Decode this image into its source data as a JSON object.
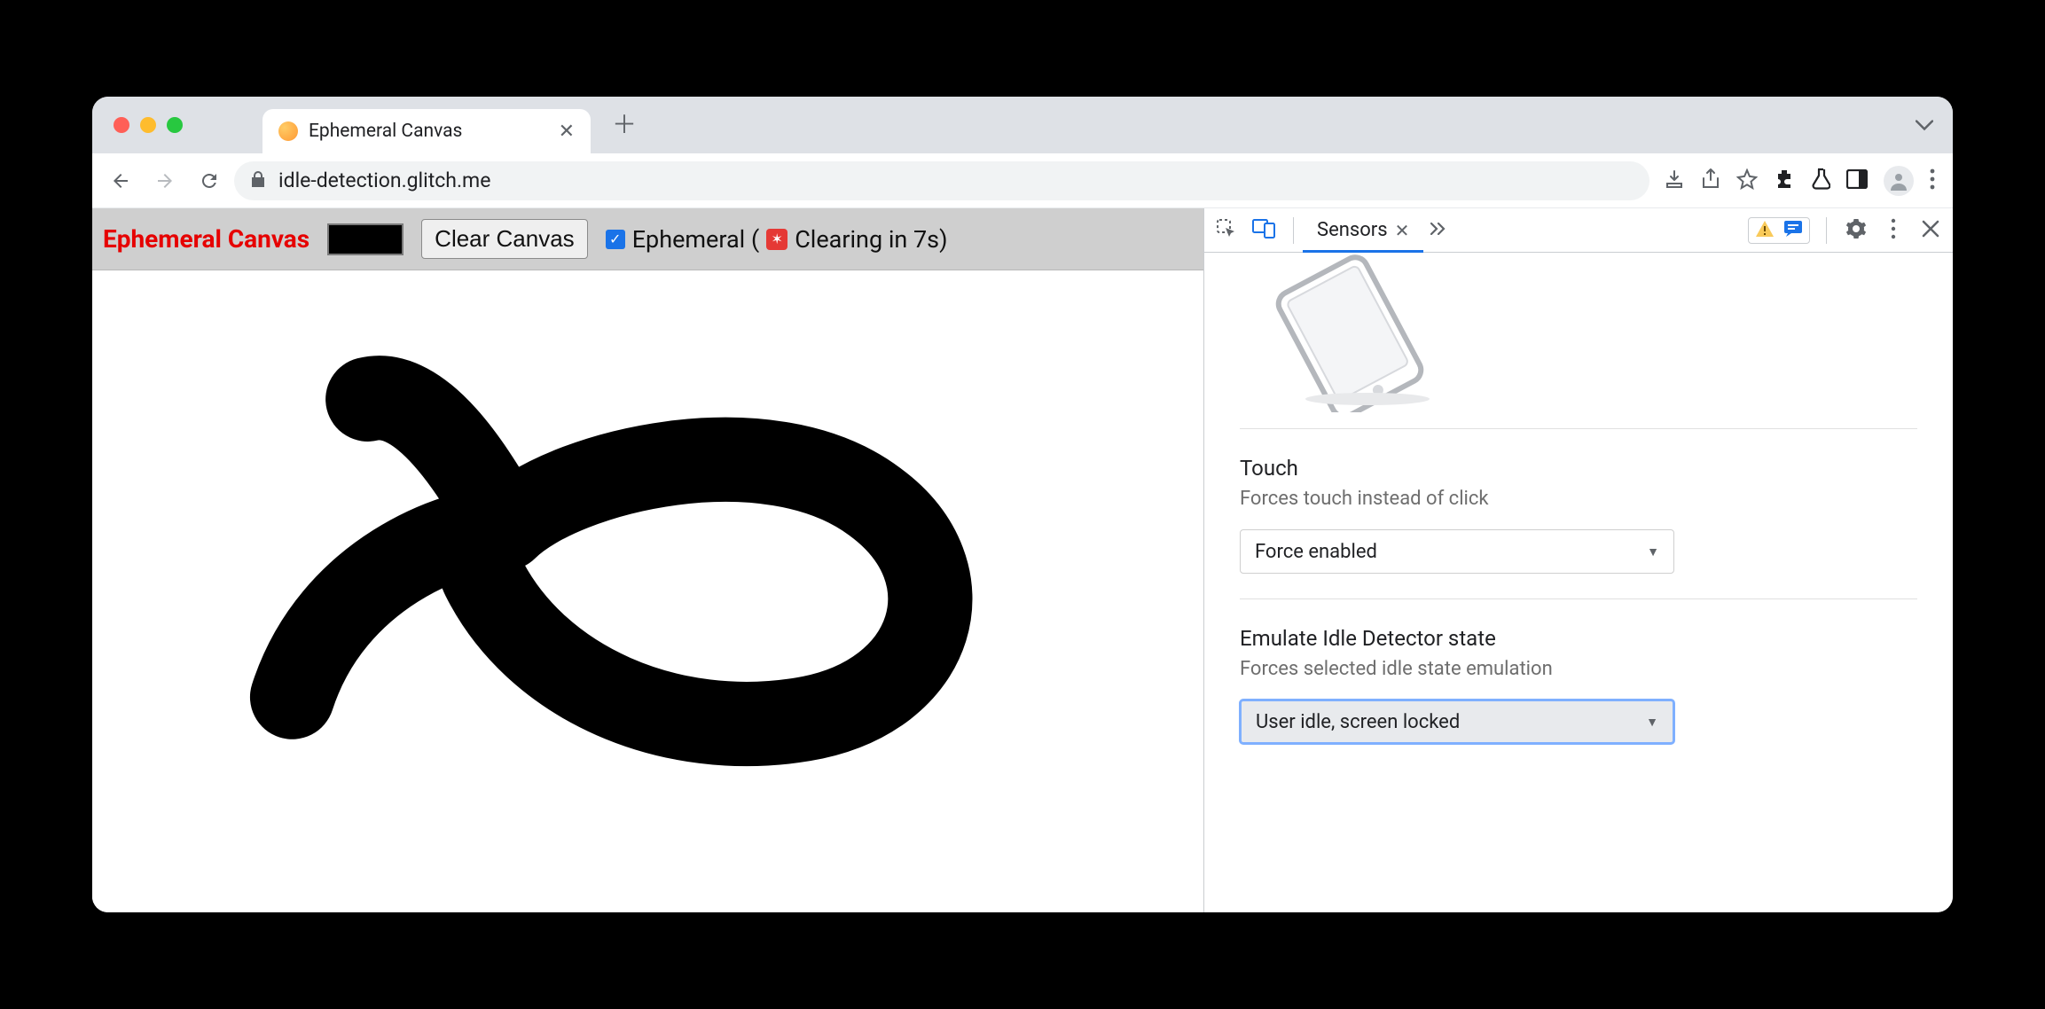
{
  "browser": {
    "tab_title": "Ephemeral Canvas",
    "url": "idle-detection.glitch.me"
  },
  "page": {
    "title": "Ephemeral Canvas",
    "clear_label": "Clear Canvas",
    "ephemeral_label_prefix": "Ephemeral (",
    "ephemeral_label_suffix": " Clearing in 7s)",
    "ephemeral_checked": true,
    "color": "#000000"
  },
  "devtools": {
    "active_tab": "Sensors",
    "sections": {
      "touch": {
        "heading": "Touch",
        "sub": "Forces touch instead of click",
        "value": "Force enabled"
      },
      "idle": {
        "heading": "Emulate Idle Detector state",
        "sub": "Forces selected idle state emulation",
        "value": "User idle, screen locked"
      }
    }
  }
}
